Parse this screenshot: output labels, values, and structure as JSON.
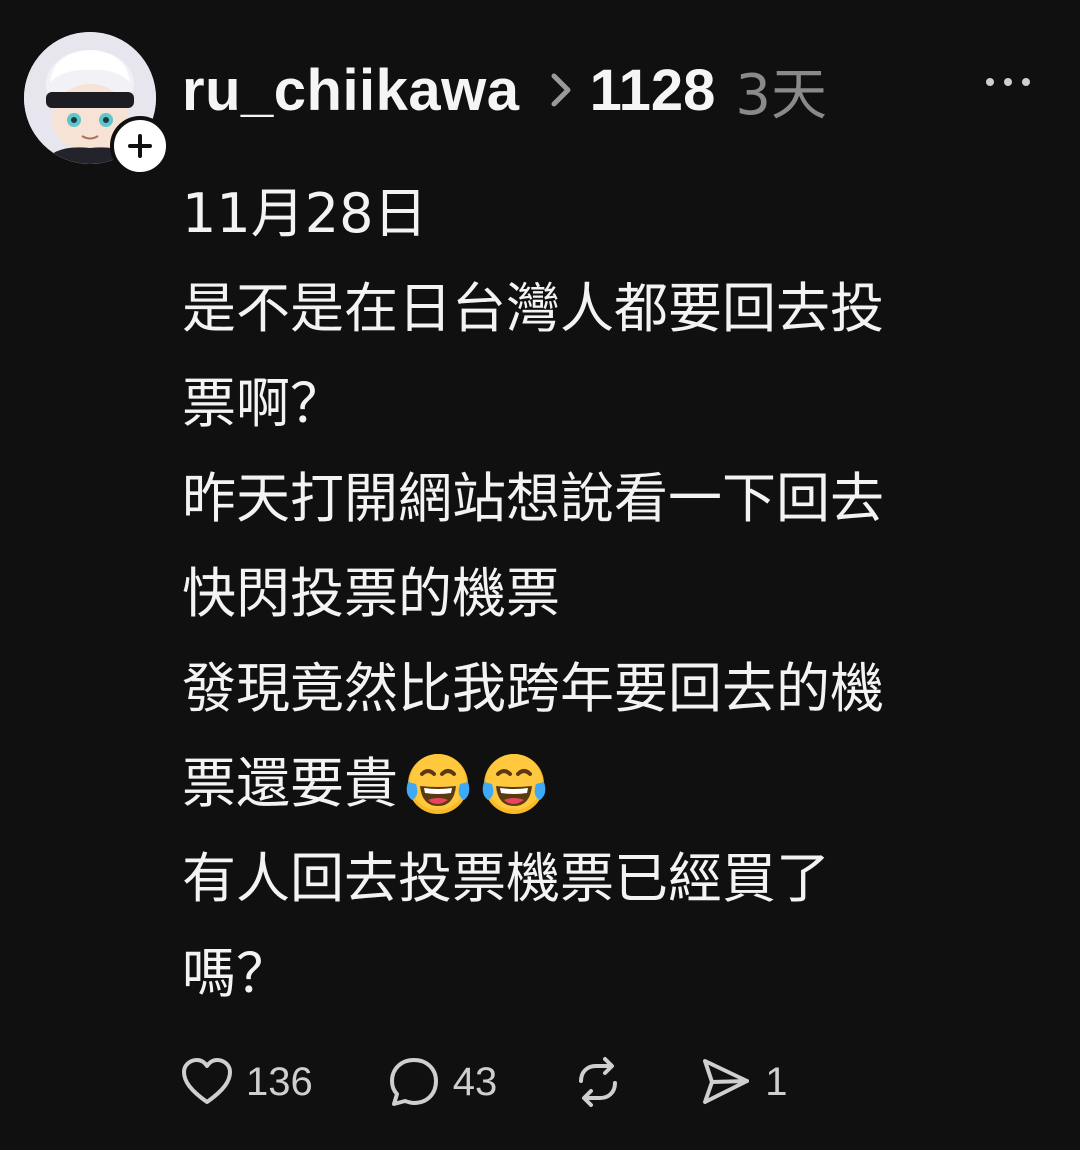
{
  "post": {
    "author": {
      "username": "ru_chiikawa",
      "avatar_icon": "plush-doll-avatar",
      "follow_icon": "plus-icon"
    },
    "topic_tag": "1128",
    "time_ago": "3天",
    "menu_icon": "more-horizontal-icon",
    "body_lines": [
      {
        "text": "11月28日"
      },
      {
        "text": "是不是在日台灣人都要回去投"
      },
      {
        "text": "票啊？"
      },
      {
        "text": "昨天打開網站想說看一下回去"
      },
      {
        "text": "快閃投票的機票"
      },
      {
        "text": "發現竟然比我跨年要回去的機"
      },
      {
        "text": "票還要貴",
        "emoji": [
          "face-with-tears-of-joy",
          "face-with-tears-of-joy"
        ]
      },
      {
        "text": "有人回去投票機票已經買了"
      },
      {
        "text": "嗎？"
      }
    ],
    "actions": {
      "likes": "136",
      "comments": "43",
      "reposts": "",
      "shares": "1"
    }
  },
  "colors": {
    "background": "#101010",
    "text": "#f3f3f3",
    "muted": "#8a8a8a"
  }
}
